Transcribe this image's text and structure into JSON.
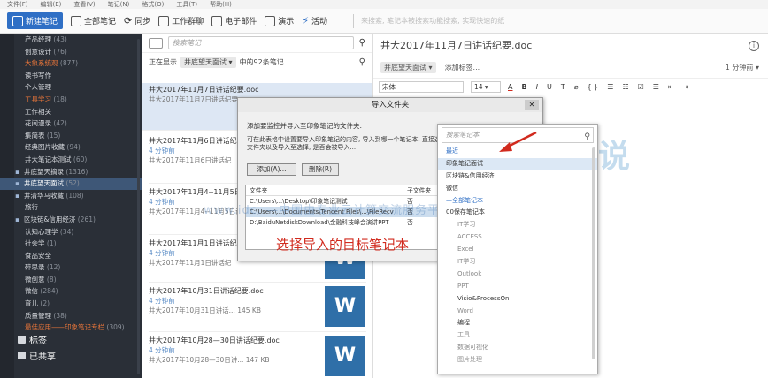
{
  "menubar": [
    "文件(F)",
    "编辑(E)",
    "查看(V)",
    "笔记(N)",
    "格式(O)",
    "工具(T)",
    "帮助(H)"
  ],
  "toolbar": {
    "new_note": "新建笔记",
    "all_notes": "全部笔记",
    "sync": "同步",
    "work_chat": "工作群聊",
    "email": "电子邮件",
    "present": "演示",
    "activity": "活动",
    "search_placeholder": "来搜索, 笔记本被搜索功能搜索, 实现快速的纸"
  },
  "sidebar": {
    "items": [
      {
        "label": "产品经理",
        "count": "(43)",
        "kind": "normal"
      },
      {
        "label": "创意设计",
        "count": "(76)",
        "kind": "normal"
      },
      {
        "label": "大象系统观",
        "count": "(877)",
        "kind": "red"
      },
      {
        "label": "读书写作",
        "count": "",
        "kind": "normal"
      },
      {
        "label": "个人管理",
        "count": "",
        "kind": "normal"
      },
      {
        "label": "工具学习",
        "count": "(18)",
        "kind": "red"
      },
      {
        "label": "工作相关",
        "count": "",
        "kind": "normal"
      },
      {
        "label": "花间漫录",
        "count": "(42)",
        "kind": "normal"
      },
      {
        "label": "集简表",
        "count": "(15)",
        "kind": "normal"
      },
      {
        "label": "经典图片收藏",
        "count": "(94)",
        "kind": "normal"
      },
      {
        "label": "井大笔记本测试",
        "count": "(60)",
        "kind": "normal"
      },
      {
        "label": "井底望天摘录",
        "count": "(1316)",
        "kind": "stack"
      },
      {
        "label": "井底望天面试",
        "count": "(52)",
        "kind": "stack-active"
      },
      {
        "label": "井清华马收藏",
        "count": "(108)",
        "kind": "stack"
      },
      {
        "label": "旅行",
        "count": "",
        "kind": "normal"
      },
      {
        "label": "区块链&信用经济",
        "count": "(261)",
        "kind": "stack"
      },
      {
        "label": "认知心理学",
        "count": "(34)",
        "kind": "normal"
      },
      {
        "label": "社会学",
        "count": "(1)",
        "kind": "normal"
      },
      {
        "label": "食品安全",
        "count": "",
        "kind": "normal"
      },
      {
        "label": "碎思录",
        "count": "(12)",
        "kind": "normal"
      },
      {
        "label": "微创意",
        "count": "(8)",
        "kind": "normal"
      },
      {
        "label": "微信",
        "count": "(284)",
        "kind": "normal"
      },
      {
        "label": "育儿",
        "count": "(2)",
        "kind": "normal"
      },
      {
        "label": "质量管理",
        "count": "(38)",
        "kind": "normal"
      },
      {
        "label": "最佳应用——印象笔记专栏",
        "count": "(309)",
        "kind": "red"
      }
    ],
    "tags": "标签",
    "shared": "已共享"
  },
  "notelist": {
    "search_placeholder": "搜索笔记",
    "showing": "正在显示",
    "notebook": "井底望天面试",
    "count_text": "中的92条笔记",
    "notes": [
      {
        "title": "井大2017年11月7日讲话纪要.doc",
        "time": "",
        "snip": "井大2017年11月7日讲话纪要"
      },
      {
        "title": "井大2017年11月6日讲话纪",
        "time": "4 分钟前",
        "snip": "井大2017年11月6日讲话纪"
      },
      {
        "title": "井大2017年11月4--11月5日讲话纪要.doc",
        "time": "4 分钟前",
        "snip": "井大2017年11月4--11月5日讲"
      },
      {
        "title": "井大2017年11月1日讲话纪",
        "time": "4 分钟前",
        "snip": "井大2017年11月1日讲话纪"
      },
      {
        "title": "井大2017年10月31日讲话纪要.doc",
        "time": "4 分钟前",
        "snip": "井大2017年10月31日讲话...  145 KB"
      },
      {
        "title": "井大2017年10月28—30日讲话纪要.doc",
        "time": "4 分钟前",
        "snip": "井大2017年10月28—30日讲...  147 KB"
      }
    ],
    "thumb_letter": "W"
  },
  "editor": {
    "title": "井大2017年11月7日讲话纪要.doc",
    "notebook": "井底望天面试",
    "add_tag": "添加标签...",
    "version": "1 分钟前",
    "font": "宋体",
    "size": "14",
    "format_buttons": [
      "A",
      "B",
      "I",
      "U",
      "T",
      "⌀",
      "{ }",
      "☰",
      "☷",
      "☑",
      "☰",
      "⇤",
      "⇥"
    ],
    "info": "i"
  },
  "dialog": {
    "title": "导入文件夹",
    "close": "✕",
    "line1": "添加要监控并导入至印象笔记的文件夹:",
    "para": "可在此表格中设置要导入印象笔记的内容, 导入到哪一个笔记本, 直接选择文件夹以及导入至选择, 是否会被导入...",
    "add_button": "添加(A)...",
    "delete_button": "删除(R)",
    "col_folder": "文件夹",
    "col_sub": "子文件夹",
    "rows": [
      {
        "path": "C:\\Users\\...\\Desktop\\印象笔记测试",
        "sub": "否"
      },
      {
        "path": "C:\\Users\\...\\Documents\\Tencent Files\\...\\FileRecv",
        "sub": "否"
      },
      {
        "path": "D:\\BaiduNetdiskDownload\\金融科技峰会演讲PPT",
        "sub": "否"
      }
    ],
    "annotation": "选择导入的目标笔记本"
  },
  "picker": {
    "search_placeholder": "搜索笔记本",
    "items": [
      {
        "label": "最近",
        "kind": "accent"
      },
      {
        "label": "印象笔记面试",
        "kind": "hl"
      },
      {
        "label": "区块链&信用经济",
        "kind": "normal"
      },
      {
        "label": "微信",
        "kind": "normal"
      },
      {
        "label": "—全部笔记本",
        "kind": "accent"
      },
      {
        "label": "00保存笔记本",
        "kind": "normal"
      },
      {
        "label": "IT学习",
        "kind": "sub"
      },
      {
        "label": "ACCESS",
        "kind": "sub"
      },
      {
        "label": "Excel",
        "kind": "sub"
      },
      {
        "label": "IT学习",
        "kind": "sub"
      },
      {
        "label": "Outlook",
        "kind": "sub"
      },
      {
        "label": "PPT",
        "kind": "sub"
      },
      {
        "label": "Visio&ProcessOn",
        "kind": "sub-dark"
      },
      {
        "label": "Word",
        "kind": "sub"
      },
      {
        "label": "编程",
        "kind": "sub-dark"
      },
      {
        "label": "工具",
        "kind": "sub"
      },
      {
        "label": "数据可视化",
        "kind": "sub"
      },
      {
        "label": "图片处理",
        "kind": "sub"
      }
    ]
  },
  "watermark": {
    "line": "www.idc.  —中国由专业云计算交流服务平台—",
    "big": "云说"
  },
  "colors": {
    "accent": "#2f6fc5",
    "sidebar_bg": "#2a2f37",
    "annotation_red": "#d12a1e",
    "word_blue": "#2f6fa8"
  }
}
